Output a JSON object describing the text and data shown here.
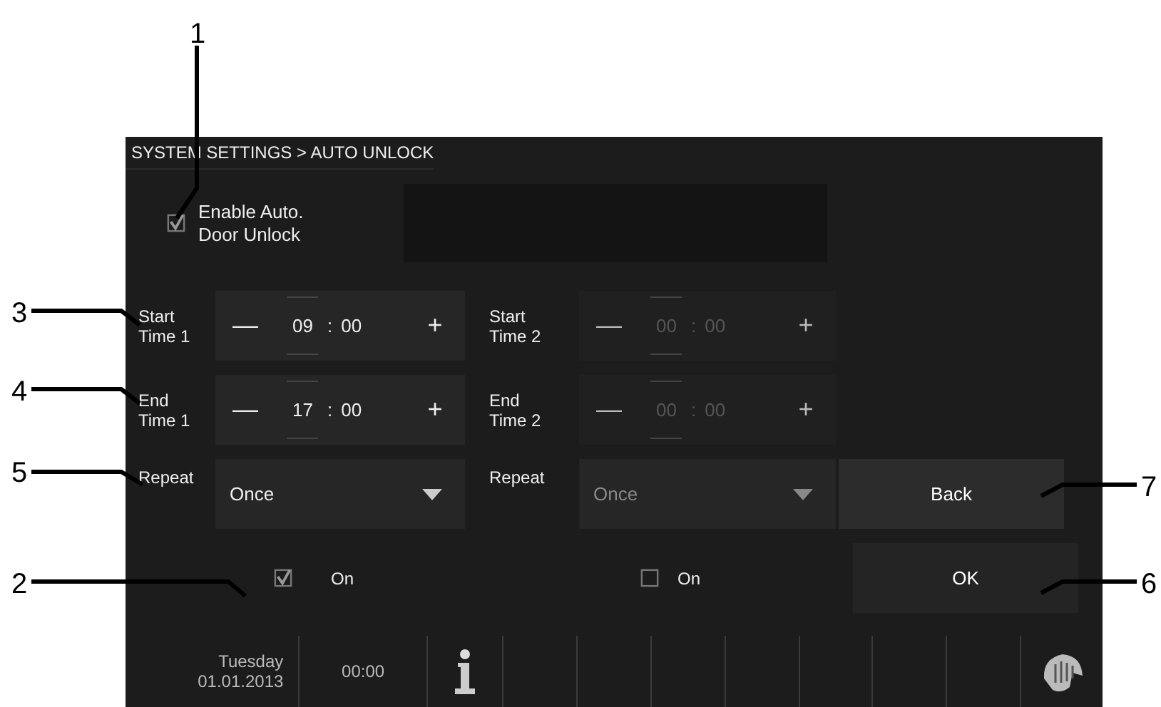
{
  "breadcrumb": "SYSTEM SETTINGS > AUTO UNLOCK",
  "enable": {
    "label": "Enable Auto.\nDoor Unlock",
    "checked": true
  },
  "schedules": [
    {
      "disabled": false,
      "start_label": "Start\nTime 1",
      "start": {
        "minus": "—",
        "hours": "09",
        "separator": ":",
        "minutes": "00",
        "plus": "+"
      },
      "end_label": "End\nTime 1",
      "end": {
        "minus": "—",
        "hours": "17",
        "separator": ":",
        "minutes": "00",
        "plus": "+"
      },
      "repeat_label": "Repeat",
      "repeat": "Once",
      "on_label": "On",
      "checked": true
    },
    {
      "disabled": true,
      "start_label": "Start\nTime 2",
      "start": {
        "minus": "—",
        "hours": "00",
        "separator": ":",
        "minutes": "00",
        "plus": "+"
      },
      "end_label": "End\nTime 2",
      "end": {
        "minus": "—",
        "hours": "00",
        "separator": ":",
        "minutes": "00",
        "plus": "+"
      },
      "repeat_label": "Repeat",
      "repeat": "Once",
      "on_label": "On",
      "checked": false
    }
  ],
  "buttons": [
    {
      "label": "Back"
    },
    {
      "label": "OK"
    }
  ],
  "status_bar": {
    "day": "Tuesday",
    "date": "01.01.2013",
    "time": "00:00"
  },
  "callouts": [
    "1",
    "3",
    "4",
    "5",
    "2",
    "7",
    "6"
  ]
}
